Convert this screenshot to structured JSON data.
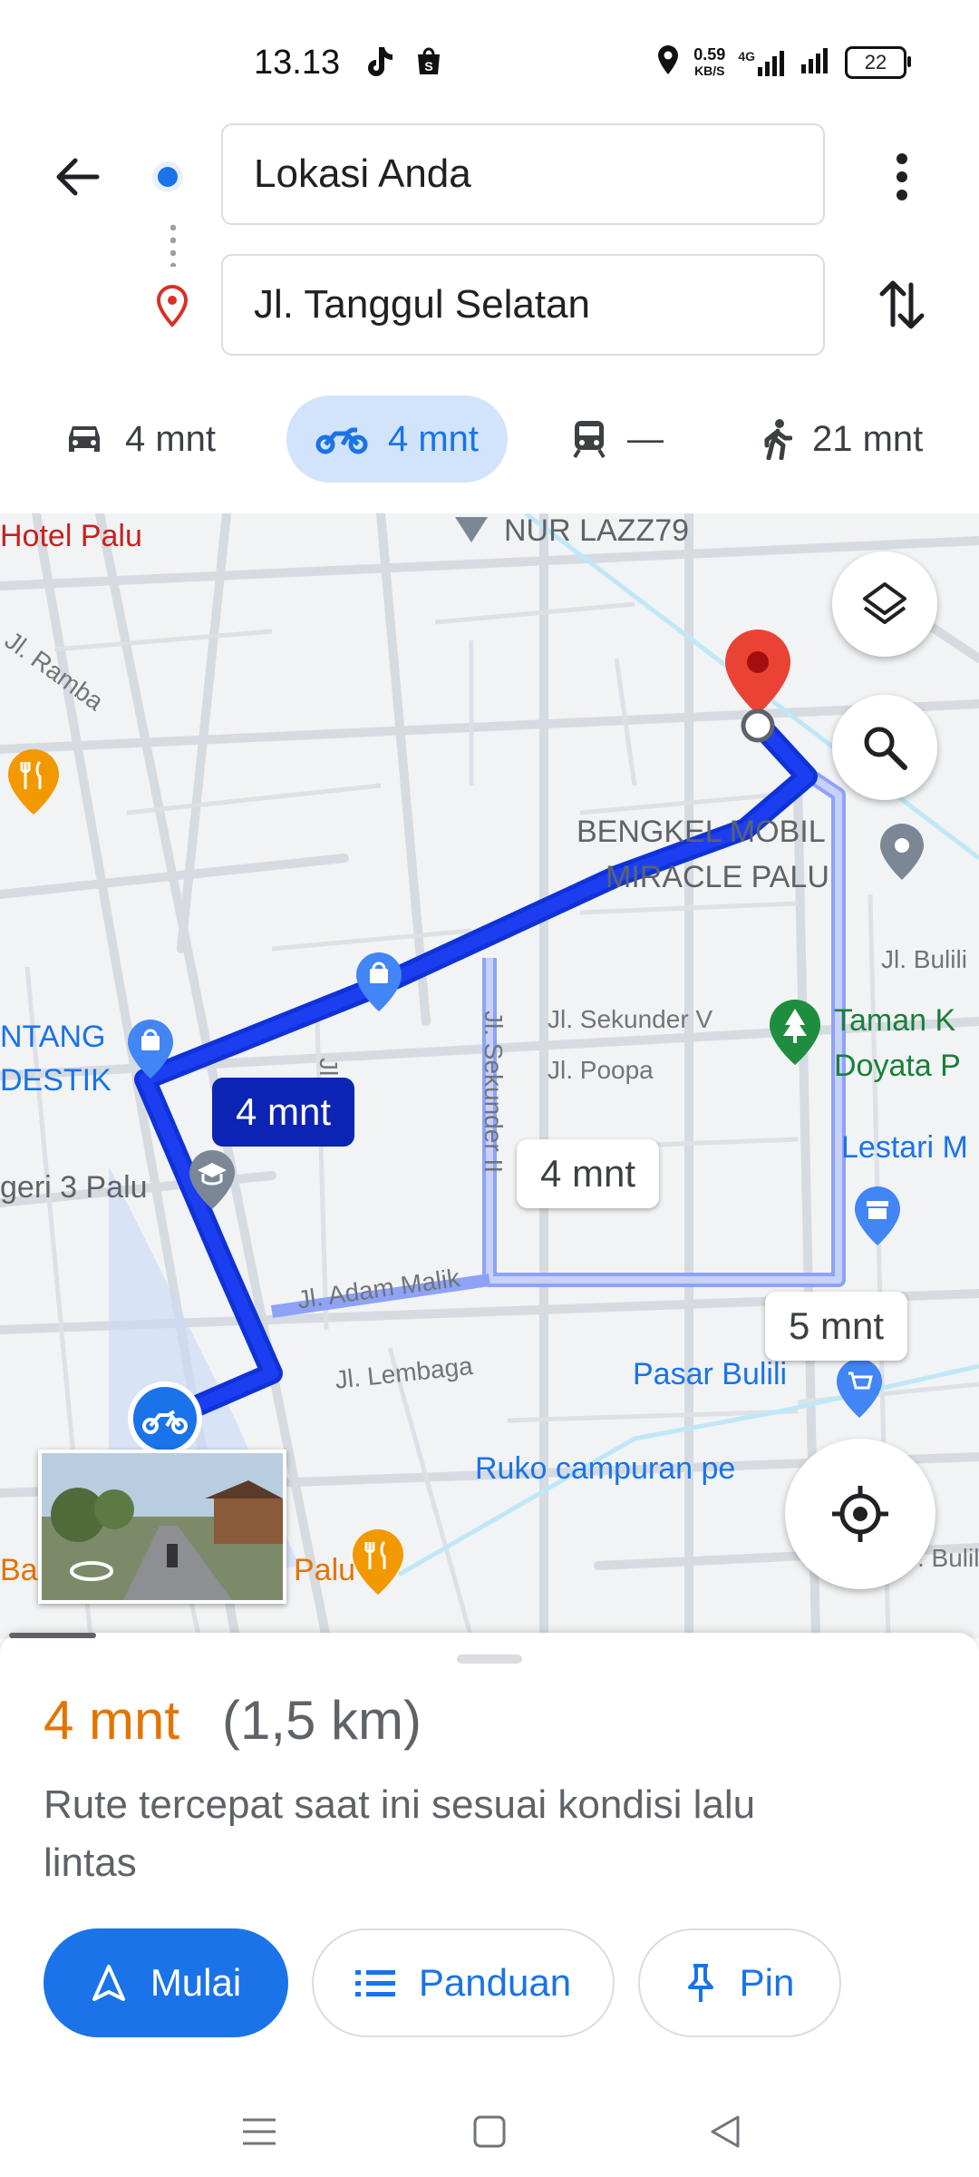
{
  "status_bar": {
    "time": "13.13",
    "speed_value": "0.59",
    "speed_unit": "KB/S",
    "network": "4G",
    "battery": "22"
  },
  "search": {
    "origin": "Lokasi Anda",
    "destination": "Jl. Tanggul Selatan"
  },
  "modes": [
    {
      "name": "car",
      "time": "4 mnt",
      "selected": false
    },
    {
      "name": "motorcycle",
      "time": "4 mnt",
      "selected": true
    },
    {
      "name": "transit",
      "time": "—",
      "selected": false
    },
    {
      "name": "walk",
      "time": "21 mnt",
      "selected": false
    }
  ],
  "map": {
    "labels": {
      "hotel": "Hotel Palu",
      "nur": "NUR LAZZ79",
      "ramba": "Jl. Ramba",
      "bengkel1": "BENGKEL MOBIL",
      "bengkel2": "MIRACLE PALU",
      "bulili1": "Jl. Bulili",
      "taman1": "Taman K",
      "taman2": "Doyata P",
      "sekunder5": "Jl. Sekunder V",
      "poopa": "Jl. Poopa",
      "sekunder2": "Jl. Sekunder II",
      "air": "Jl. Air",
      "ntang": "NTANG",
      "destik": "DESTIK",
      "geri": "geri 3 Palu",
      "lestari": "Lestari M",
      "adam": "Jl. Adam Malik",
      "lembaga": "Jl. Lembaga",
      "pasar": "Pasar Bulili",
      "ruko": "Ruko campuran pe",
      "ba": "Ba",
      "palu": "Palu",
      "bulili2": ". Bulil"
    },
    "route_bubbles": {
      "selected": "4 mnt",
      "alt1": "4 mnt",
      "alt2": "5 mnt"
    }
  },
  "sheet": {
    "time": "4 mnt",
    "distance": "(1,5 km)",
    "description": "Rute tercepat saat ini sesuai kondisi lalu lintas",
    "buttons": {
      "start": "Mulai",
      "guide": "Panduan",
      "pin": "Pin"
    }
  },
  "colors": {
    "accent": "#1a73e8",
    "route_selected": "#1b3ff0",
    "route_alt": "#9aaefb",
    "time_orange": "#e37400",
    "pin_red": "#ea4335"
  }
}
